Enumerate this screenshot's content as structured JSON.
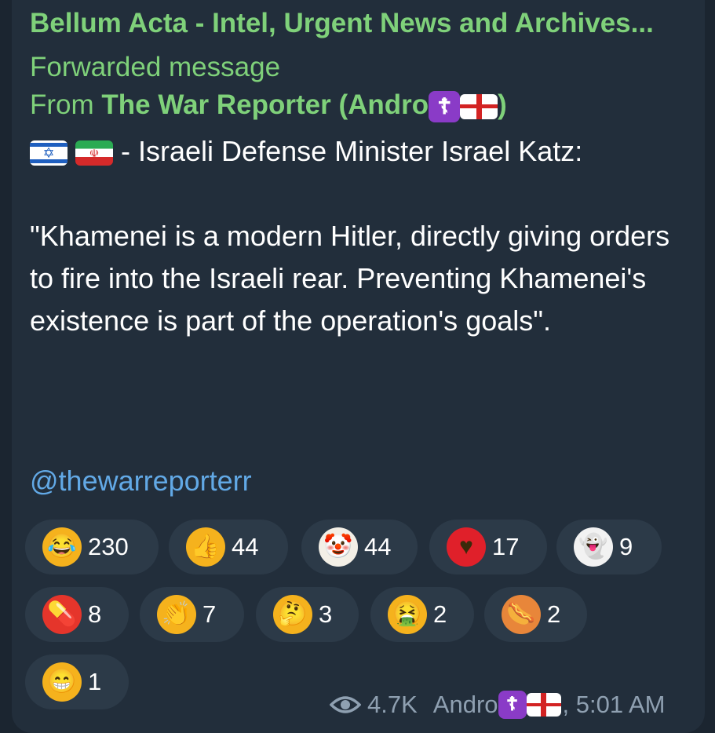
{
  "message": {
    "channel_title": "Bellum Acta - Intel, Urgent News and Archives...",
    "forwarded_label": "Forwarded message",
    "from_prefix": "From",
    "from_name": "The War Reporter (Andro",
    "from_suffix": ")",
    "headline": "- Israeli Defense Minister Israel Katz:",
    "quote": "\"Khamenei is a modern Hitler, directly giving orders to fire into the Israeli rear. Preventing Khamenei's existence is part of the operation's goals\".",
    "username": "@thewarreporterr"
  },
  "reactions": [
    {
      "icon": "rofl-emoji",
      "glyph": "😂",
      "color": "#f5b21d",
      "count": "230"
    },
    {
      "icon": "thumbs-up-emoji",
      "glyph": "👍",
      "color": "#f5b21d",
      "count": "44"
    },
    {
      "icon": "clown-emoji",
      "glyph": "🤡",
      "color": "#f3efe6",
      "count": "44"
    },
    {
      "icon": "heart-emoji",
      "glyph": "♥",
      "color": "#e0202a",
      "count": "17"
    },
    {
      "icon": "ghost-emoji",
      "glyph": "👻",
      "color": "#f2f2f2",
      "count": "9"
    },
    {
      "icon": "pill-emoji",
      "glyph": "💊",
      "color": "#e5352b",
      "count": "8"
    },
    {
      "icon": "clapping-hands-emoji",
      "glyph": "👏",
      "color": "#f5b21d",
      "count": "7"
    },
    {
      "icon": "thinking-face-emoji",
      "glyph": "🤔",
      "color": "#f5b21d",
      "count": "3"
    },
    {
      "icon": "vomiting-face-emoji",
      "glyph": "🤮",
      "color": "#f5b21d",
      "count": "2"
    },
    {
      "icon": "hot-dog-emoji",
      "glyph": "🌭",
      "color": "#e8863a",
      "count": "2"
    },
    {
      "icon": "grinning-face-emoji",
      "glyph": "😁",
      "color": "#f5b21d",
      "count": "1"
    }
  ],
  "footer": {
    "views": "4.7K",
    "author": "Andro",
    "time": ", 5:01 AM"
  },
  "colors": {
    "background": "#1b2530",
    "bubble": "#222e3b",
    "accent_green": "#7fd17a",
    "link_blue": "#62a9e6",
    "reaction_pill": "#2c3a48",
    "meta_gray": "#8fa0b1"
  }
}
